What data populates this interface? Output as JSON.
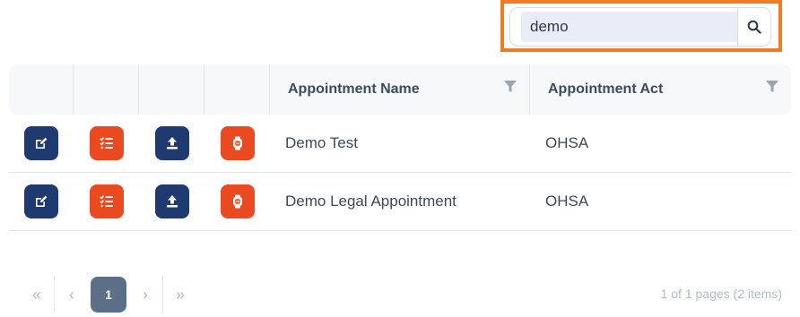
{
  "search": {
    "value": "demo",
    "button_icon": "search-icon"
  },
  "table": {
    "columns": [
      "",
      "",
      "",
      "",
      "Appointment Name",
      "Appointment Act"
    ],
    "rows": [
      {
        "name": "Demo Test",
        "act": "OHSA"
      },
      {
        "name": "Demo Legal Appointment",
        "act": "OHSA"
      }
    ],
    "row_actions": [
      "edit-icon",
      "checklist-icon",
      "upload-icon",
      "device-icon"
    ]
  },
  "pagination": {
    "first": "«",
    "prev": "‹",
    "current": "1",
    "next": "›",
    "last": "»",
    "summary": "1 of 1 pages (2 items)"
  },
  "colors": {
    "highlight": "#f07b24",
    "navy": "#1f3a70",
    "orange": "#ea4a1f",
    "page_active": "#5b7088"
  }
}
